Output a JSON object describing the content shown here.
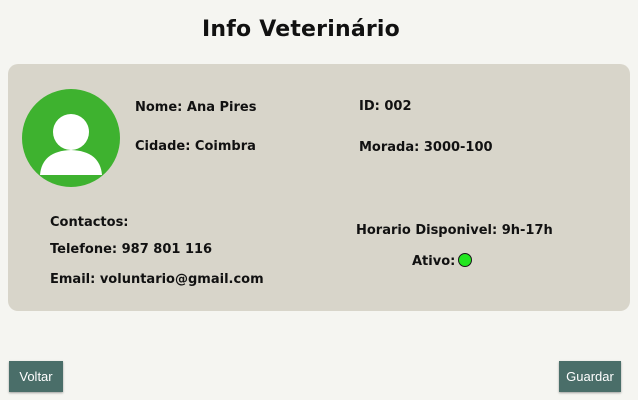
{
  "page": {
    "title": "Info Veterinário"
  },
  "vet": {
    "name_text": "Nome: Ana Pires",
    "city_text": "Cidade: Coimbra",
    "id_text": "ID: 002",
    "address_text": "Morada: 3000-100",
    "contacts_label": "Contactos:",
    "phone_text": "Telefone: 987 801 116",
    "email_text": "Email: voluntario@gmail.com",
    "schedule_text": "Horario Disponivel: 9h-17h",
    "active_label": "Ativo:",
    "active_status": true
  },
  "buttons": {
    "back_label": "Voltar",
    "save_label": "Guardar"
  },
  "colors": {
    "background": "#f5f5f1",
    "card": "#d8d5ca",
    "avatar": "#3eb22f",
    "status_active": "#22e61f",
    "button": "#4a6e69"
  },
  "icons": {
    "avatar": "user-avatar-icon",
    "status": "status-dot-icon"
  }
}
